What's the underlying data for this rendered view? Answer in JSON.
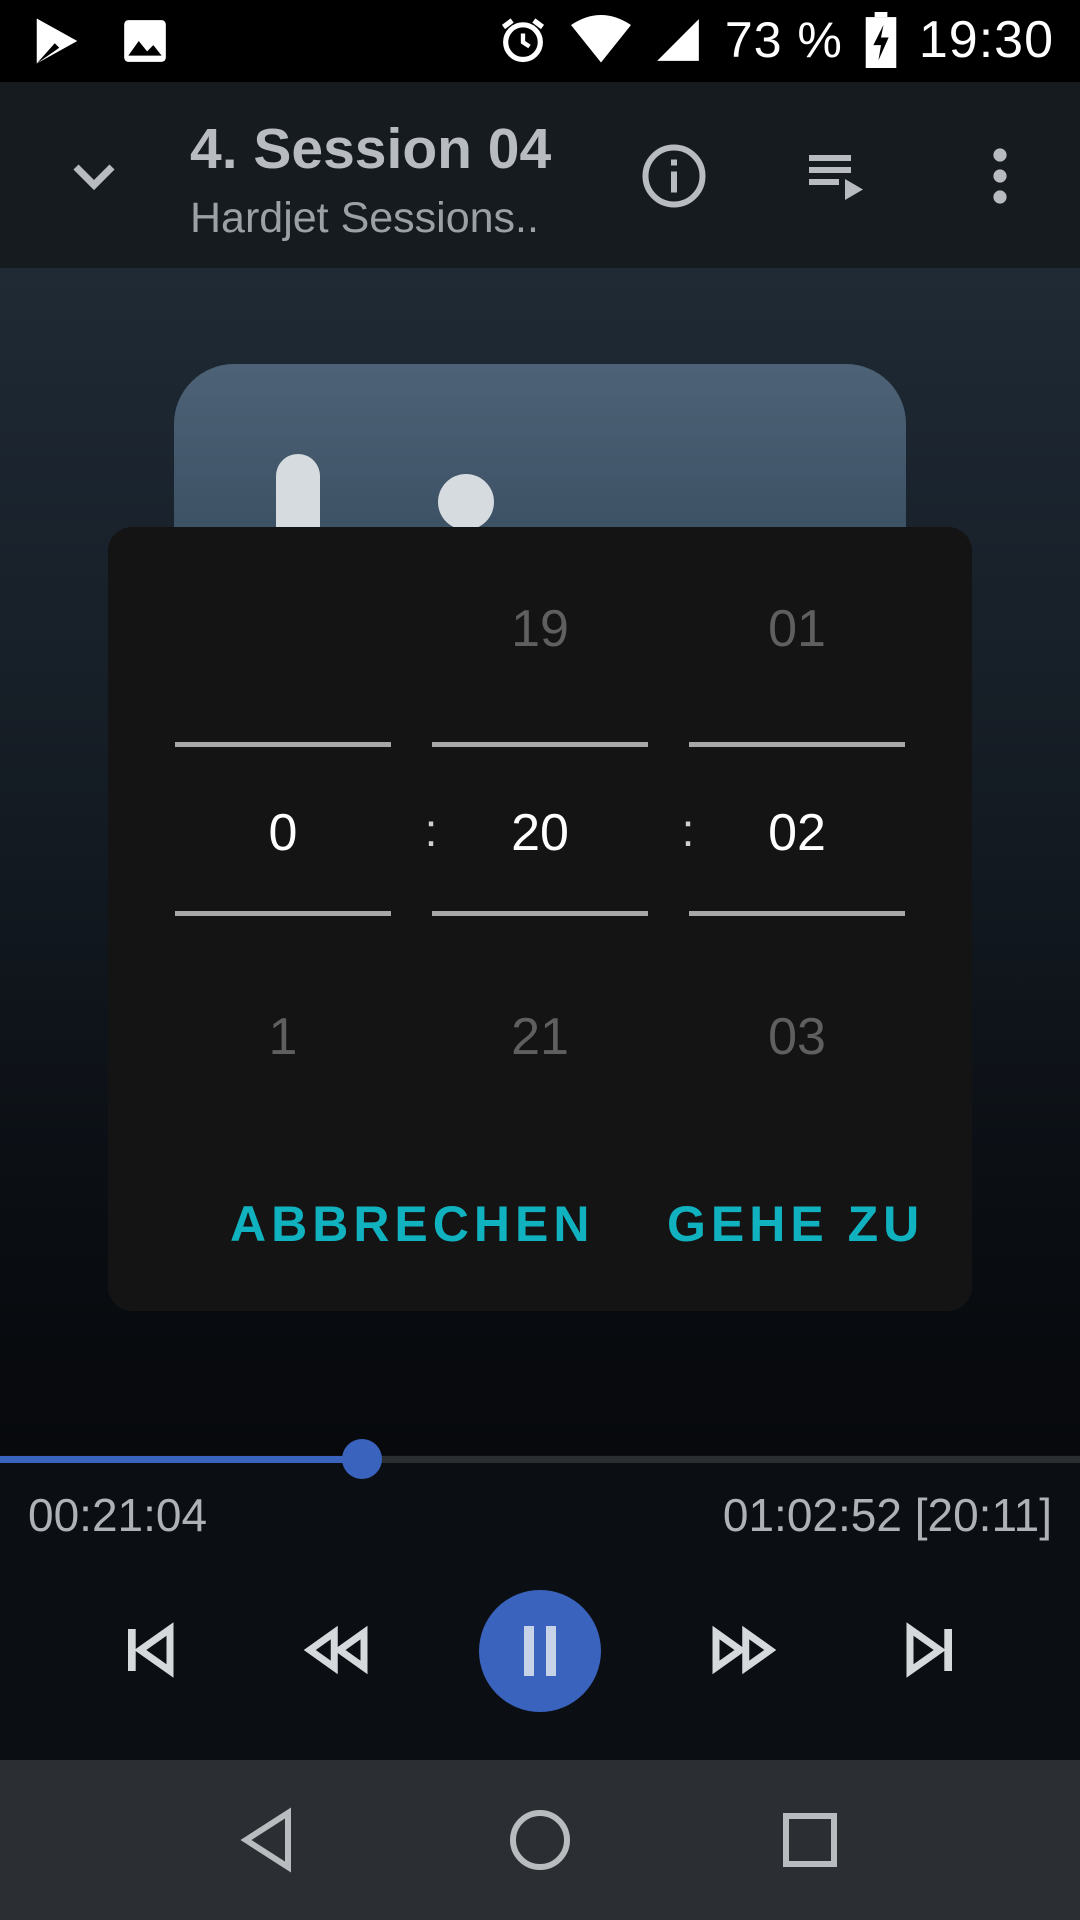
{
  "status_bar": {
    "battery_text": "73 %",
    "time": "19:30",
    "icons": [
      "play-store-icon",
      "image-icon",
      "alarm-icon",
      "wifi-icon",
      "signal-icon",
      "battery-charging-icon"
    ]
  },
  "app_bar": {
    "title": "4. Session 04",
    "subtitle": "Hardjet Sessions..",
    "icons": [
      "chevron-down-icon",
      "info-icon",
      "queue-icon",
      "more-vert-icon"
    ]
  },
  "dialog": {
    "hours": {
      "prev": "",
      "selected": "0",
      "next": "1"
    },
    "minutes": {
      "prev": "19",
      "selected": "20",
      "next": "21"
    },
    "seconds": {
      "prev": "01",
      "selected": "02",
      "next": "03"
    },
    "separator": ":",
    "cancel_label": "ABBRECHEN",
    "go_label": "GEHE ZU"
  },
  "player": {
    "elapsed": "00:21:04",
    "duration": "01:02:52 [20:11]",
    "progress_fraction": 0.335,
    "accent_color": "#3a63bd",
    "dialog_button_color": "#11b2bf",
    "controls": [
      "skip-previous-icon",
      "rewind-icon",
      "pause-icon",
      "fast-forward-icon",
      "skip-next-icon"
    ]
  },
  "nav_bar": {
    "icons": [
      "back-icon",
      "home-icon",
      "recents-icon"
    ]
  }
}
